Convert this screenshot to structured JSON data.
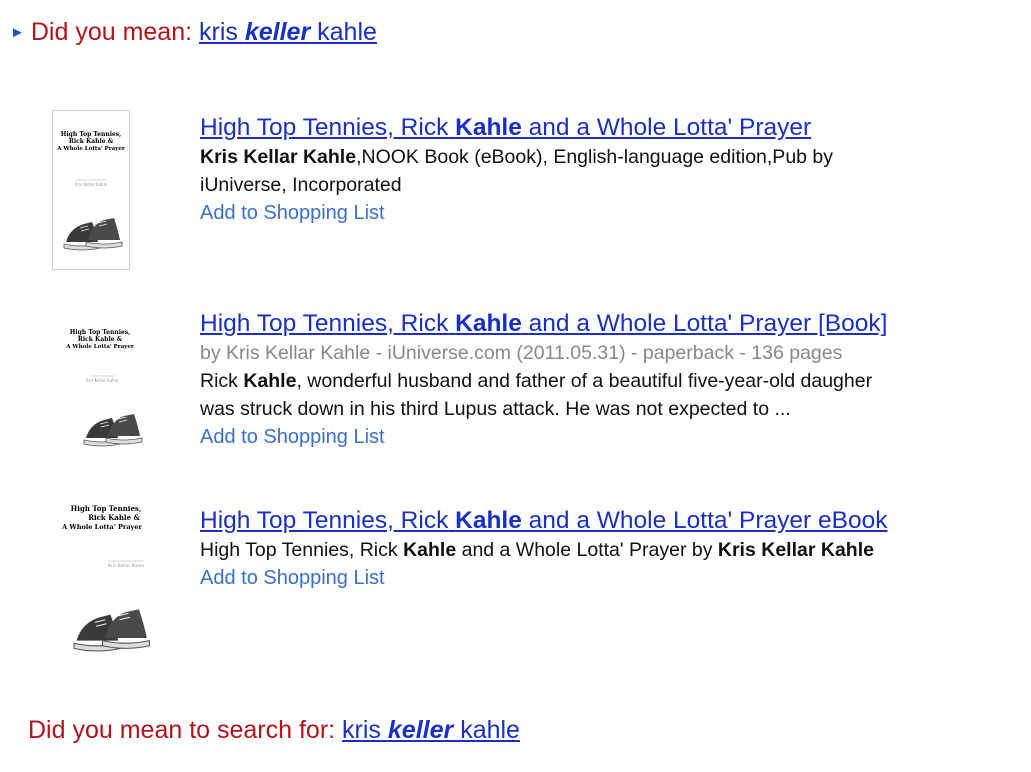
{
  "top_suggestion": {
    "prefix": "Did you mean:",
    "query_before": "kris",
    "query_emph": "keller",
    "query_after": "kahle"
  },
  "results": [
    {
      "title_a": "High Top Tennies, Rick",
      "title_b": "Kahle",
      "title_c": "and a Whole Lotta' Prayer",
      "desc_author": "Kris Kellar Kahle",
      "desc_rest": ",NOOK Book (eBook), English-language edition,Pub by",
      "desc_line2": "iUniverse, Incorporated",
      "add_label": "Add to Shopping List"
    },
    {
      "title_a": "High Top Tennies, Rick",
      "title_b": "Kahle",
      "title_c": "and a Whole Lotta' Prayer [Book]",
      "meta": "by Kris Kellar Kahle - iUniverse.com (2011.05.31) - paperback - 136 pages",
      "snippet_a": "Rick",
      "snippet_b": "Kahle",
      "snippet_c": ", wonderful husband and father of a beautiful five-year-old daugher",
      "snippet_line2": "was struck down in his third Lupus attack. He was not expected to ...",
      "add_label": "Add to Shopping List"
    },
    {
      "title_a": "High Top Tennies, Rick",
      "title_b": "Kahle",
      "title_c": "and a Whole Lotta' Prayer eBook",
      "desc_a": "High Top Tennies, Rick",
      "desc_b": "Kahle",
      "desc_c": "and a Whole Lotta' Prayer by",
      "desc_d": "Kris Kellar Kahle",
      "add_label": "Add to Shopping List"
    }
  ],
  "cover": {
    "line1": "High Top Tennies,",
    "line2": "Rick Kahle &",
    "line3": "A Whole Lotta' Prayer",
    "author": "Kris Kellar Kahle"
  },
  "bottom_suggestion": {
    "prefix": "Did you mean to search for:",
    "query_before": "kris",
    "query_emph": "keller",
    "query_after": "kahle"
  },
  "colors": {
    "link": "#1a2fc4",
    "suggestion_text": "#b3141b",
    "add_link": "#3a6fd0",
    "meta_gray": "#888888"
  }
}
